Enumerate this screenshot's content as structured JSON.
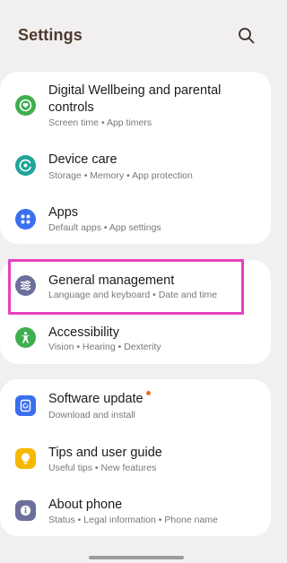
{
  "header": {
    "title": "Settings",
    "search_icon": "search-icon"
  },
  "groups": [
    {
      "items": [
        {
          "icon": "digital-wellbeing-icon",
          "icon_color": "#3fae4f",
          "title_line1": "Digital Wellbeing and parental",
          "title_line2": "controls",
          "subtitle": "Screen time  •  App timers"
        },
        {
          "icon": "device-care-icon",
          "icon_color": "#1fa59a",
          "title_line1": "Device care",
          "subtitle": "Storage  •  Memory  •  App protection"
        },
        {
          "icon": "apps-icon",
          "icon_color": "#3b6ff0",
          "title_line1": "Apps",
          "subtitle": "Default apps  •  App settings"
        }
      ]
    },
    {
      "items": [
        {
          "icon": "general-management-icon",
          "icon_color": "#6c6f9c",
          "title_line1": "General management",
          "subtitle": "Language and keyboard  •  Date and time",
          "highlighted": true
        },
        {
          "icon": "accessibility-icon",
          "icon_color": "#3fae4f",
          "title_line1": "Accessibility",
          "subtitle": "Vision  •  Hearing  •  Dexterity"
        }
      ]
    },
    {
      "items": [
        {
          "icon": "software-update-icon",
          "icon_color": "#3b6ff0",
          "title_line1": "Software update",
          "subtitle": "Download and install",
          "badge_color": "#ef6a2d"
        },
        {
          "icon": "tips-icon",
          "icon_color": "#f5b800",
          "title_line1": "Tips and user guide",
          "subtitle": "Useful tips  •  New features"
        },
        {
          "icon": "about-phone-icon",
          "icon_color": "#6c6f9c",
          "title_line1": "About phone",
          "subtitle": "Status  •  Legal information  •  Phone name"
        }
      ]
    }
  ]
}
